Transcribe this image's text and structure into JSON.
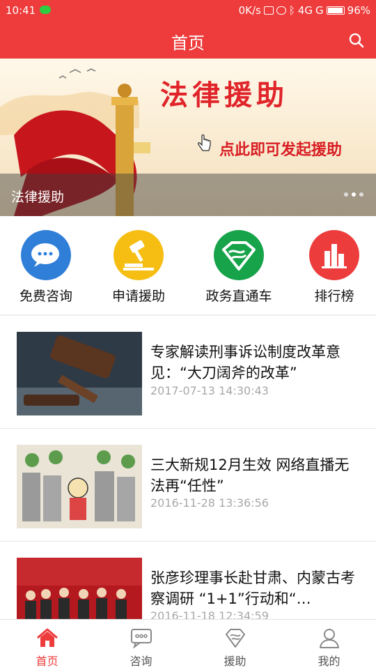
{
  "status_bar": {
    "time": "10:41",
    "network_speed": "0K/s",
    "signal_1": "4G",
    "signal_2": "G",
    "battery": "96%",
    "battery_level": 0.96
  },
  "app_bar": {
    "title": "首页",
    "search_icon": "search-icon"
  },
  "banner": {
    "headline": "法律援助",
    "subtext": "点此即可发起援助",
    "caption": "法律援助",
    "page_count": 3,
    "active_page": 2
  },
  "features": [
    {
      "label": "免费咨询",
      "icon": "chat-bubbles-icon",
      "color": "#2f7fd9"
    },
    {
      "label": "申请援助",
      "icon": "gavel-icon",
      "color": "#f6be12"
    },
    {
      "label": "政务直通车",
      "icon": "handshake-icon",
      "color": "#16a34a"
    },
    {
      "label": "排行榜",
      "icon": "bar-chart-icon",
      "color": "#ec3c3c"
    }
  ],
  "news": [
    {
      "title": "专家解读刑事诉讼制度改革意见：“大刀阔斧的改革”",
      "time": "2017-07-13 14:30:43"
    },
    {
      "title": "三大新规12月生效 网络直播无法再“任性”",
      "time": "2016-11-28 13:36:56"
    },
    {
      "title": "张彦珍理事长赴甘肃、内蒙古考察调研 “1+1”行动和“…",
      "time": "2016-11-18 12:34:59"
    }
  ],
  "tabs": [
    {
      "label": "首页",
      "icon": "home-icon",
      "active": true
    },
    {
      "label": "咨询",
      "icon": "chat-icon",
      "active": false
    },
    {
      "label": "援助",
      "icon": "aid-icon",
      "active": false
    },
    {
      "label": "我的",
      "icon": "profile-icon",
      "active": false
    }
  ],
  "colors": {
    "brand": "#ee3b3b",
    "active_tab": "#ee3b3b"
  }
}
